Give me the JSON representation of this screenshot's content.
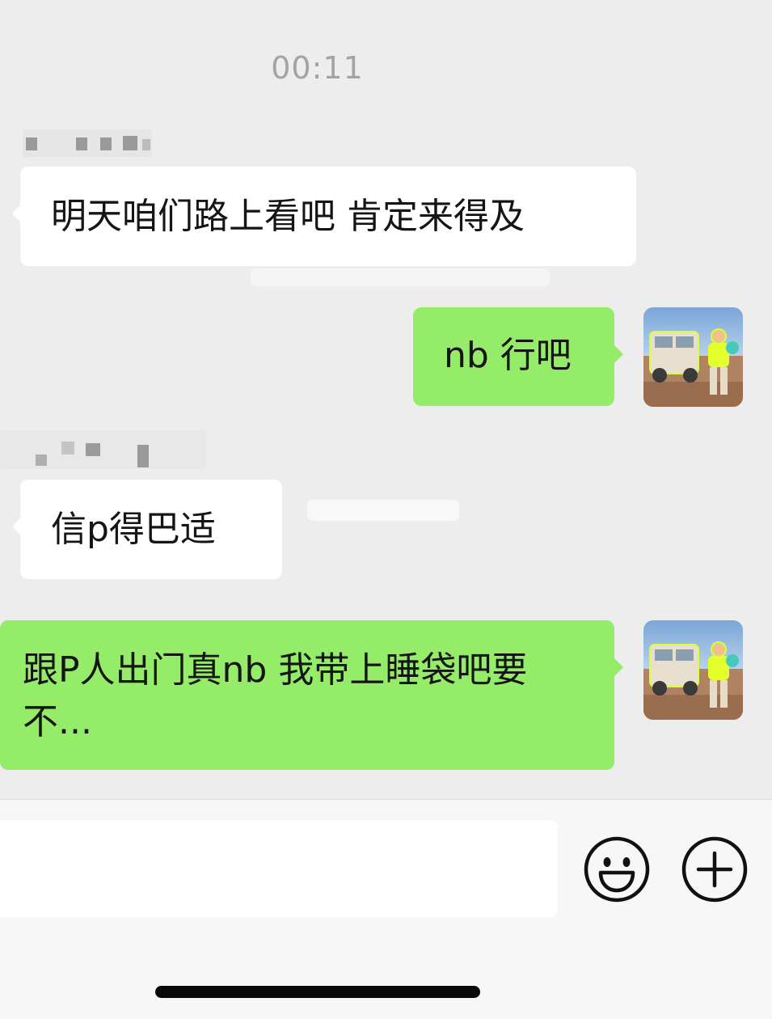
{
  "chat": {
    "timestamp": "00:11",
    "messages": [
      {
        "direction": "incoming",
        "text": "明天咱们路上看吧 肯定来得及",
        "sender_name_obscured": true
      },
      {
        "direction": "outgoing",
        "text": "nb 行吧"
      },
      {
        "direction": "incoming",
        "text": "信p得巴适",
        "sender_name_obscured": true
      },
      {
        "direction": "outgoing",
        "text": "跟P人出门真nb 我带上睡袋吧要不..."
      }
    ]
  },
  "input_bar": {
    "emoji_icon": "smiley-face-icon",
    "plus_icon": "plus-circle-icon"
  },
  "colors": {
    "background": "#ededed",
    "incoming_bubble": "#ffffff",
    "outgoing_bubble": "#95ec69",
    "timestamp": "#a3a3a3"
  }
}
